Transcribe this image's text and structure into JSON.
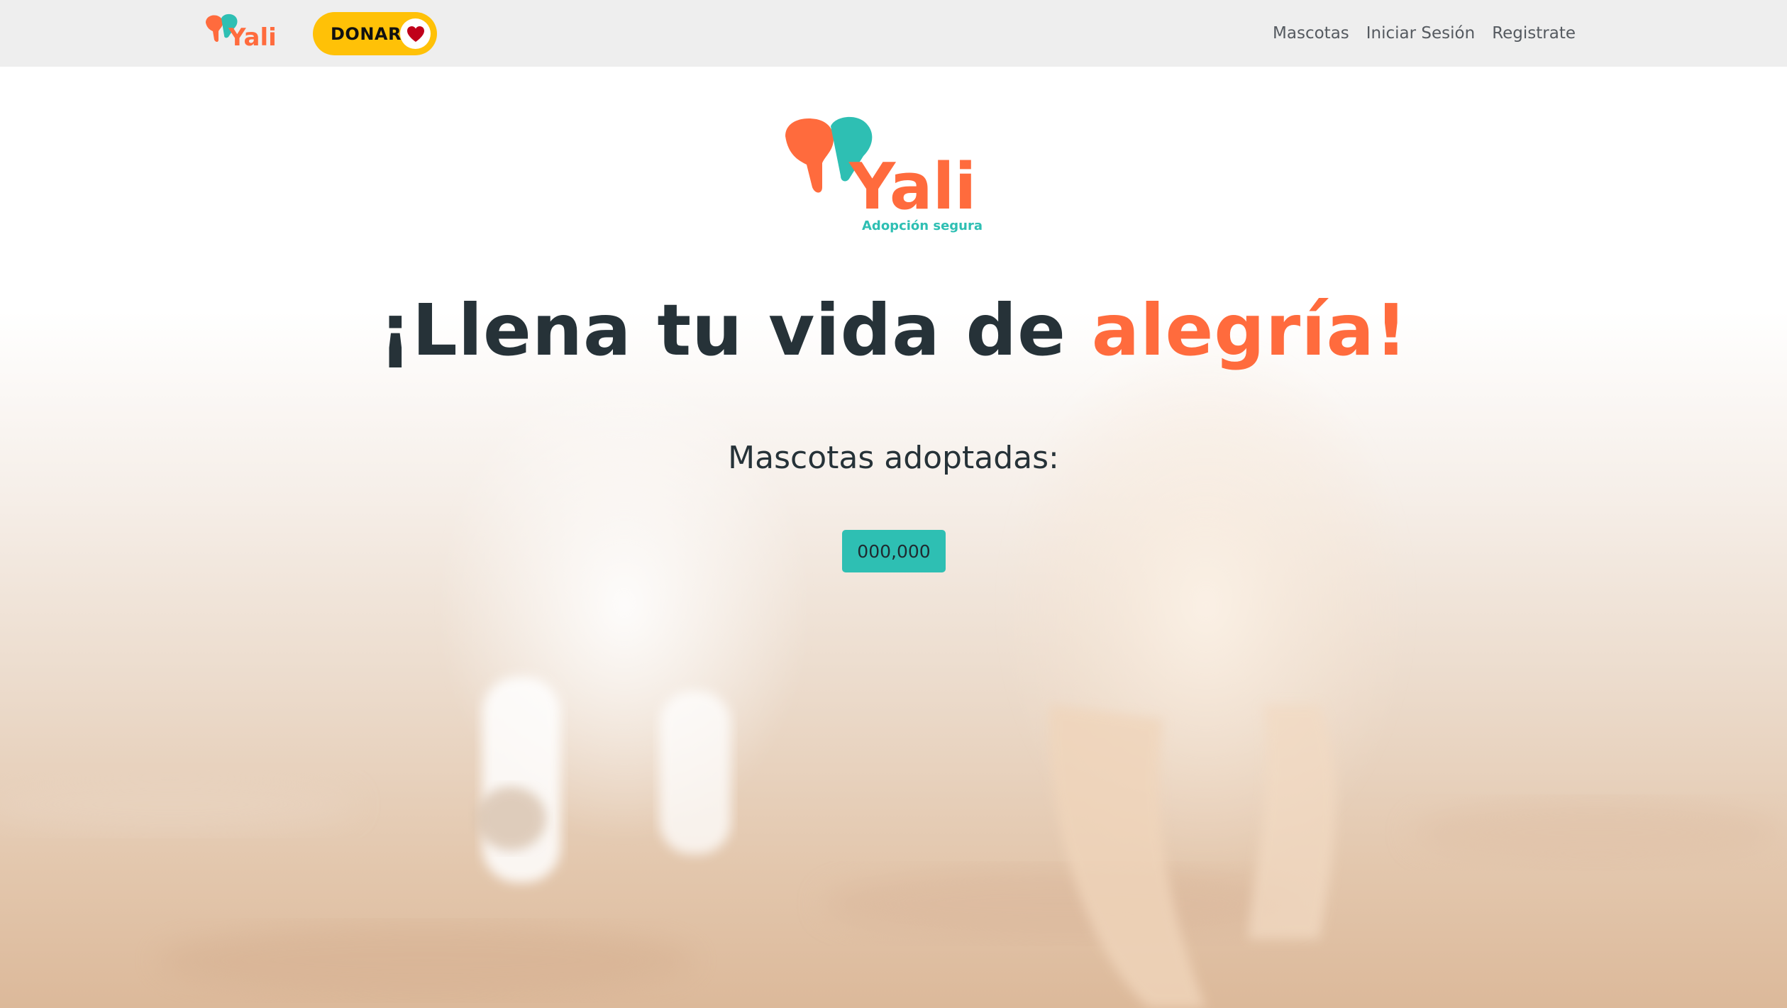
{
  "nav": {
    "logo_text": "Yali",
    "donate_label": "DONAR",
    "links": [
      "Mascotas",
      "Iniciar Sesión",
      "Registrate"
    ]
  },
  "hero": {
    "logo_text": "Yali",
    "logo_tagline": "Adopción segura",
    "title_main": "¡Llena tu vida de ",
    "title_accent": "alegría!",
    "counter_label": "Mascotas adoptadas:",
    "counter_value": "000,000"
  },
  "icons": {
    "donate": "heart-icon",
    "logo": "yali-logo"
  },
  "colors": {
    "navbar_bg": "#eeeeee",
    "donate_bg": "#ffc107",
    "heart": "#c0001a",
    "accent_orange": "#ff6b3d",
    "accent_teal": "#2ebfb3",
    "title_dark": "#263238"
  }
}
